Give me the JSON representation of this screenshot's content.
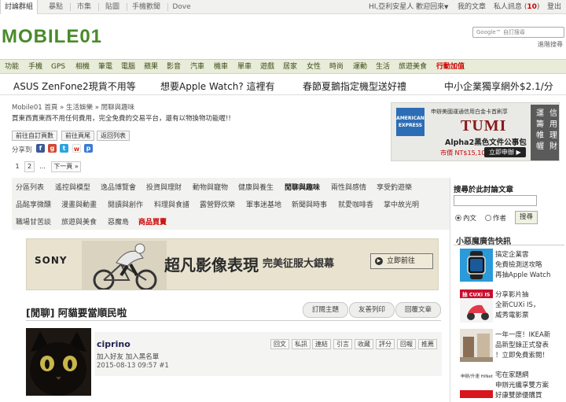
{
  "topbar": {
    "tabs": [
      "討論群組",
      "暴點",
      "市集",
      "貼圖",
      "手機歡聞",
      "Dove"
    ],
    "greeting": "HI,亞利安星人 歡迎回來",
    "my_posts": "我的文章",
    "private_msg": "私人訊息",
    "pm_count": "10",
    "logout": "登出"
  },
  "header": {
    "logo_text": "MOBILE01",
    "search_placeholder": "Google™ 自訂搜尋",
    "advanced_search": "進階搜尋"
  },
  "nav": {
    "items": [
      "功能",
      "手機",
      "GPS",
      "相機",
      "筆電",
      "電腦",
      "蘋果",
      "影音",
      "汽車",
      "機車",
      "單車",
      "遊戲",
      "居家",
      "女性",
      "時尚",
      "運動",
      "生活",
      "旅遊美食"
    ],
    "hot_item": "行動加值"
  },
  "promos": [
    "ASUS ZenFone2現貨不用等",
    "想要Apple Watch? 這裡有",
    "春節夏鵝指定機型送好禮",
    "中小企業獨享網外$2.1/分"
  ],
  "forum": {
    "breadcrumb": "Mobile01 首頁 » 生活娛樂 » 閒聊與趣味",
    "intro": "買東西賣東西不用任何費用，完全免費的交易平台，還有以物換物功能喔!!",
    "actions": [
      "前往自訂頁數",
      "前往頁尾",
      "返回列表"
    ],
    "share_label": "分享到",
    "pages": [
      "1",
      "2",
      "...",
      "下一頁 »"
    ]
  },
  "tumi_ad": {
    "amex_label": "AMERICAN EXPRESS",
    "subtitle": "申辦美國運通信用白金卡首刷享",
    "logo": "TUMI",
    "product": "Alpha2黑色文件公事包",
    "price": "市價 NT$15,100",
    "buy_label": "立即申辦 ▶",
    "card_chars": [
      "信",
      "用",
      "理",
      "財",
      "運",
      "籌",
      "帷",
      "幄"
    ]
  },
  "categories": {
    "row1": [
      "分區列表",
      "遙控與模型",
      "逸品博覽會",
      "投資與理財",
      "動物與寵物",
      "健康與養生",
      "閒聊與趣味",
      "兩性與感情",
      "享受釣遊樂"
    ],
    "row2": [
      "品酩享微醺",
      "漫畫與動畫",
      "閱讀與創作",
      "料理與食譜",
      "露營野炊樂",
      "軍事迷基地",
      "新聞與時事",
      "就愛咖啡香",
      "掌中故光明"
    ],
    "row3": [
      "職場甘苦談",
      "旅遊與美食",
      "惡魔島"
    ],
    "hot": "商品買賣"
  },
  "sony_ad": {
    "brand": "SONY",
    "slogan": "超凡影像表現",
    "slogan2": "完美征服大銀幕",
    "cta": "立即前往"
  },
  "thread": {
    "title": "[閒聊] 阿貓要當順民啦",
    "buttons": [
      "訂閱主題",
      "友善列印",
      "回覆文章"
    ]
  },
  "post": {
    "username": "ciprino",
    "user_links": "加入好友 加入黑名單",
    "date": "2015-08-13 09:57",
    "floor": "#1",
    "tools": [
      "回文",
      "私訊",
      "連結",
      "引言",
      "收藏",
      "評分",
      "回報",
      "推薦"
    ]
  },
  "sidebar": {
    "search_title": "搜尋於此討論文章",
    "radio_content": "內文",
    "radio_author": "作者",
    "search_btn": "搜尋",
    "ad_title": "小惡魔廣告快訊",
    "ads": [
      "搞定企業雲\n免費檢測送攻略\n再抽Apple Watch",
      "分享影片抽\n全新CUXi IS，\n威秀電影票",
      "一年一度！IKEA新\n品新型錄正式發表\n！立即免費索閱！",
      "宅在家題網\n申辦光纖享雙方案\n好康雙節優購買"
    ],
    "ad_label_cuxi": "抽 CUXi IS",
    "ad_label_hinet": "申辦/升速 HiNet"
  },
  "colors": {
    "nav_bg": "#e8ecd9",
    "hot_red": "#cc0000",
    "logo_green": "#4a8a2a"
  }
}
